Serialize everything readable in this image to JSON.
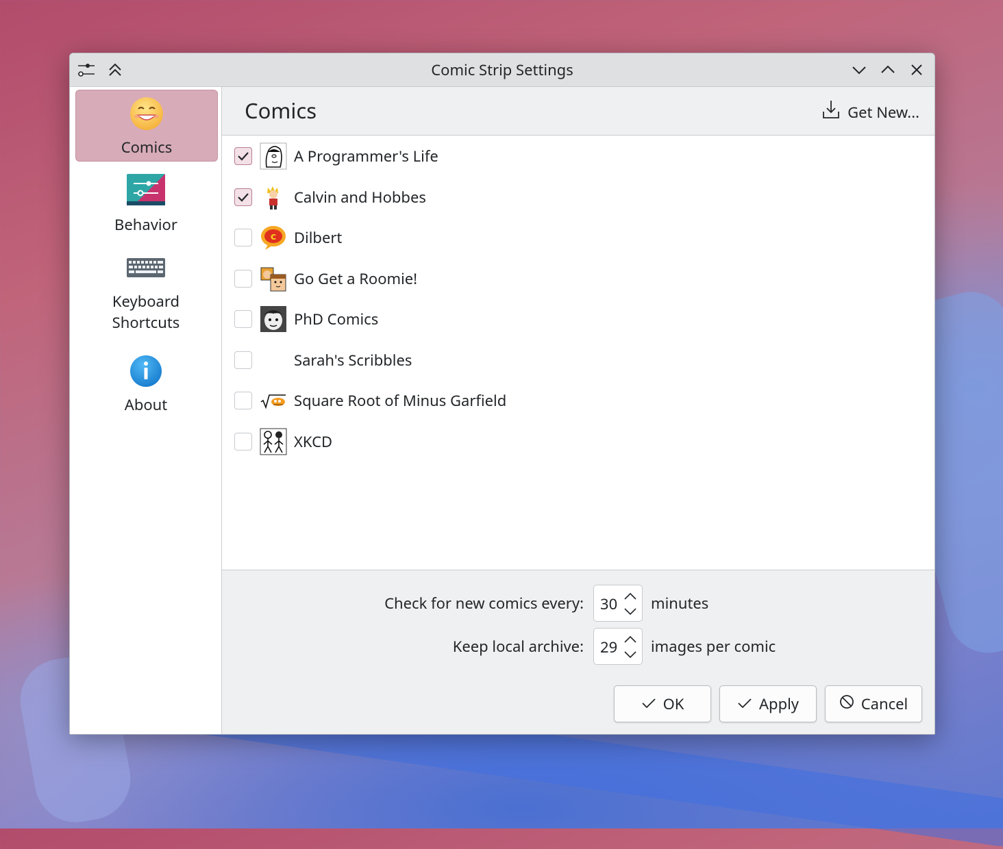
{
  "window": {
    "title": "Comic Strip Settings"
  },
  "titlebar": {
    "left_icons": [
      "settings-sliders-icon",
      "keep-above-icon"
    ],
    "right_icons": [
      "minimize-icon",
      "maximize-icon",
      "close-icon"
    ]
  },
  "sidebar": {
    "items": [
      {
        "label": "Comics",
        "icon": "smiley-face-icon",
        "active": true
      },
      {
        "label": "Behavior",
        "icon": "behavior-sliders-icon",
        "active": false
      },
      {
        "label": "Keyboard Shortcuts",
        "icon": "keyboard-icon",
        "active": false
      },
      {
        "label": "About",
        "icon": "info-icon",
        "active": false
      }
    ]
  },
  "content": {
    "title": "Comics",
    "get_new_label": "Get New...",
    "get_new_icon": "download-icon"
  },
  "comics": [
    {
      "name": "A Programmer's Life",
      "checked": true,
      "icon": "programmer-comic-icon"
    },
    {
      "name": "Calvin and Hobbes",
      "checked": true,
      "icon": "calvin-comic-icon"
    },
    {
      "name": "Dilbert",
      "checked": false,
      "icon": "dilbert-comic-icon"
    },
    {
      "name": "Go Get a Roomie!",
      "checked": false,
      "icon": "roomie-comic-icon"
    },
    {
      "name": "PhD Comics",
      "checked": false,
      "icon": "phd-comic-icon"
    },
    {
      "name": "Sarah's Scribbles",
      "checked": false,
      "icon": ""
    },
    {
      "name": "Square Root of Minus Garfield",
      "checked": false,
      "icon": "garfield-sqrt-comic-icon"
    },
    {
      "name": "XKCD",
      "checked": false,
      "icon": "xkcd-comic-icon"
    }
  ],
  "settings": {
    "check_label": "Check for new comics every:",
    "check_value": "30",
    "check_suffix": "minutes",
    "archive_label": "Keep local archive:",
    "archive_value": "29",
    "archive_suffix": "images per comic"
  },
  "buttons": {
    "ok": "OK",
    "apply": "Apply",
    "cancel": "Cancel"
  },
  "colors": {
    "accent": "#d7abb8",
    "window_bg": "#eff0f1",
    "list_bg": "#ffffff",
    "text": "#232629"
  }
}
